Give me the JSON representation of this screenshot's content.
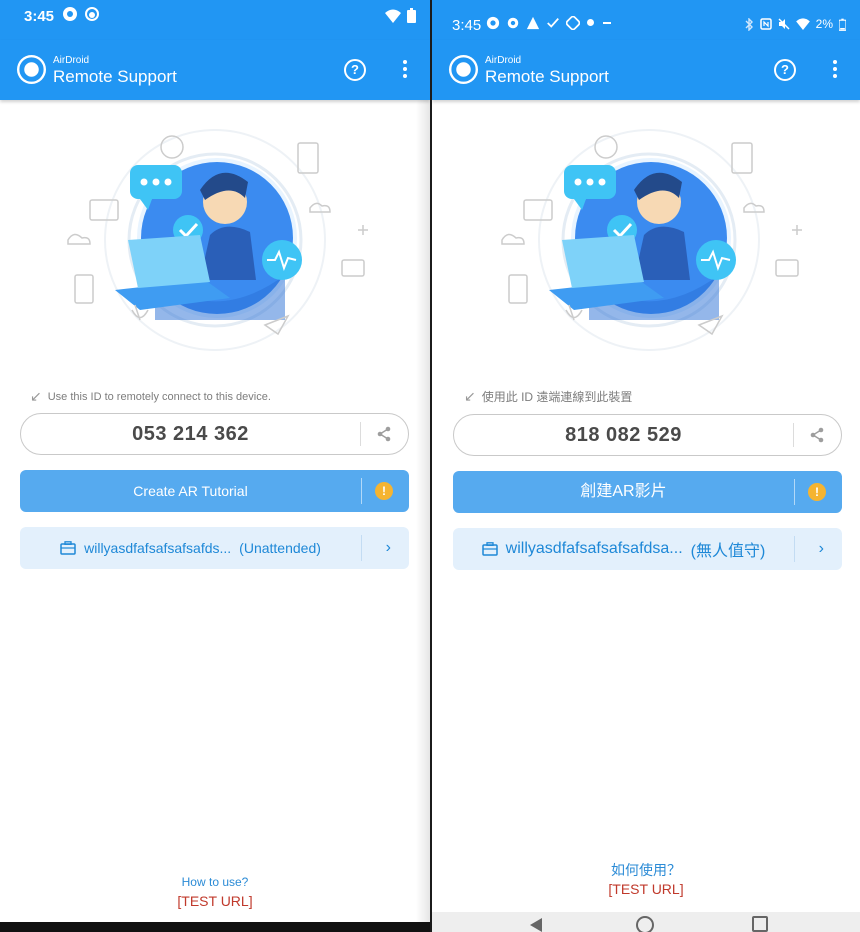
{
  "left": {
    "status": {
      "time": "3:45"
    },
    "app": {
      "brand_small": "AirDroid",
      "brand_big": "Remote Support",
      "help": "?"
    },
    "hint": "Use this ID to remotely connect to this device.",
    "device_id": "053 214 362",
    "ar_button": "Create AR Tutorial",
    "unattended": {
      "name": "willyasdfafsafsafsafds...",
      "status": "(Unattended)"
    },
    "how_to_use": "How to use?",
    "test_url": "[TEST URL]"
  },
  "right": {
    "status": {
      "time": "3:45",
      "battery": "2%"
    },
    "app": {
      "brand_small": "AirDroid",
      "brand_big": "Remote Support",
      "help": "?"
    },
    "hint": "使用此 ID 遠端連線到此裝置",
    "device_id": "818 082 529",
    "ar_button": "創建AR影片",
    "unattended": {
      "name": "willyasdfafsafsafsafdsa...",
      "status": "(無人值守)"
    },
    "how_to_use": "如何使用？",
    "test_url": "[TEST URL]"
  },
  "colors": {
    "appbar": "#2196f3",
    "ar_button": "#56aaef",
    "unattended_bg": "#e3f0fc",
    "link": "#2b8bd6",
    "warning": "#f5b431",
    "test_url": "#c0392b"
  },
  "icons": [
    "lifebuoy-logo-icon",
    "help-icon",
    "more-vert-icon",
    "share-icon",
    "warning-icon",
    "briefcase-icon",
    "chevron-right-icon",
    "arrow-hint-icon"
  ]
}
